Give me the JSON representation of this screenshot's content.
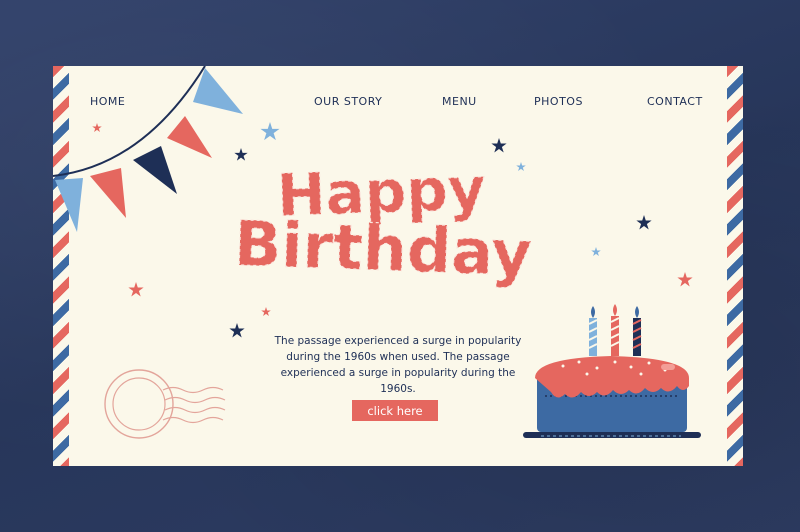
{
  "nav": {
    "home": "HOME",
    "our_story": "OUR STORY",
    "menu": "MENU",
    "photos": "PHOTOS",
    "contact": "CONTACT"
  },
  "hero": {
    "line1": "Happy",
    "line2": "Birthday"
  },
  "body_text": "The passage experienced a surge in popularity during the 1960s when used. The passage experienced a surge in popularity during the 1960s.",
  "cta_label": "click here",
  "colors": {
    "background": "#2b3a5e",
    "card": "#fbf8ea",
    "coral": "#e5675f",
    "navy": "#1e2f56",
    "blue": "#3d6aa3",
    "light_blue": "#7fb1dc"
  },
  "icons": [
    "bunting-icon",
    "star-icon",
    "postmark-icon",
    "birthday-cake-icon",
    "candle-icon"
  ]
}
